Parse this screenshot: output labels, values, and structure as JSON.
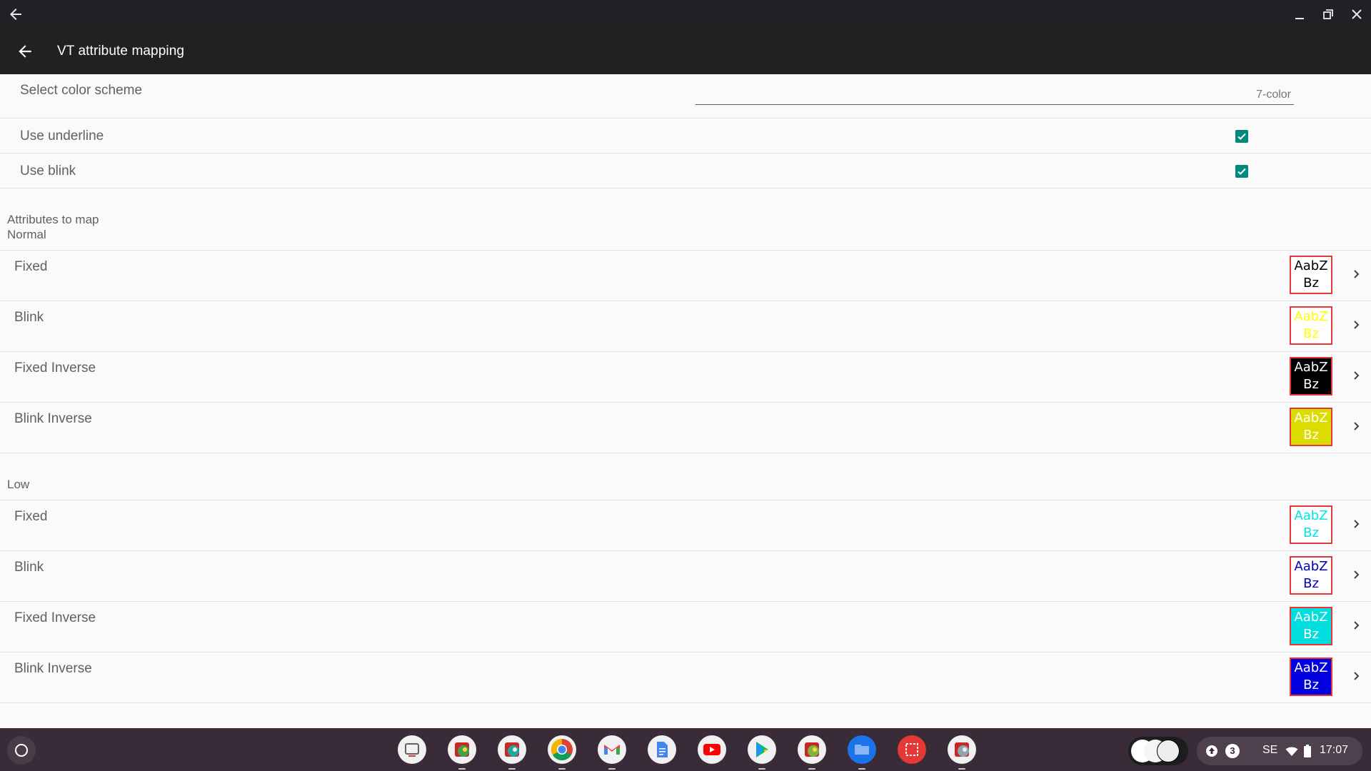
{
  "window": {
    "back_icon": "arrow-back-icon",
    "minimize_icon": "minimize-icon",
    "restore_icon": "restore-icon",
    "close_icon": "close-icon"
  },
  "appbar": {
    "title": "VT attribute mapping",
    "back_icon": "arrow-back-icon"
  },
  "settings": {
    "color_scheme": {
      "label": "Select color scheme",
      "value": "7-color"
    },
    "use_underline": {
      "label": "Use underline",
      "checked": true
    },
    "use_blink": {
      "label": "Use blink",
      "checked": true
    }
  },
  "sections": {
    "attributes_to_map": "Attributes to map",
    "normal": {
      "title": "Normal",
      "rows": [
        {
          "label": "Fixed",
          "sample": "AabZ Bz",
          "fg": "#000000",
          "bg": "#ffffff"
        },
        {
          "label": "Blink",
          "sample": "AabZ Bz",
          "fg": "#ffff00",
          "bg": "#ffffff"
        },
        {
          "label": "Fixed Inverse",
          "sample": "AabZ Bz",
          "fg": "#ffffff",
          "bg": "#000000"
        },
        {
          "label": "Blink Inverse",
          "sample": "AabZ Bz",
          "fg": "#ffffff",
          "bg": "#dcdc00"
        }
      ]
    },
    "low": {
      "title": "Low",
      "rows": [
        {
          "label": "Fixed",
          "sample": "AabZ Bz",
          "fg": "#00e5e5",
          "bg": "#ffffff"
        },
        {
          "label": "Blink",
          "sample": "AabZ Bz",
          "fg": "#0000c0",
          "bg": "#ffffff"
        },
        {
          "label": "Fixed Inverse",
          "sample": "AabZ Bz",
          "fg": "#ffffff",
          "bg": "#00dede"
        },
        {
          "label": "Blink Inverse",
          "sample": "AabZ Bz",
          "fg": "#ffffff",
          "bg": "#0000e0"
        }
      ]
    }
  },
  "shelf": {
    "launcher_icon": "launcher-icon",
    "apps": [
      {
        "name": "screen-capture-app-icon",
        "color": "#f1f1f1"
      },
      {
        "name": "terminal-app-icon",
        "color": "#f1f1f1"
      },
      {
        "name": "terminal-app-icon",
        "color": "#f1f1f1"
      },
      {
        "name": "chrome-icon",
        "color": "#f1f1f1"
      },
      {
        "name": "gmail-icon",
        "color": "#f1f1f1"
      },
      {
        "name": "docs-icon",
        "color": "#f1f1f1"
      },
      {
        "name": "youtube-icon",
        "color": "#f1f1f1"
      },
      {
        "name": "play-store-icon",
        "color": "#f1f1f1"
      },
      {
        "name": "terminal-app-icon",
        "color": "#f1f1f1"
      },
      {
        "name": "files-icon",
        "color": "#1a73e8"
      },
      {
        "name": "screenshot-app-icon",
        "color": "#e53935"
      },
      {
        "name": "terminal-app-icon",
        "color": "#f1f1f1"
      }
    ],
    "tray": {
      "notification_count": "3",
      "ime": "SE",
      "time": "17:07",
      "wifi_icon": "wifi-icon",
      "battery_icon": "battery-icon",
      "update_icon": "update-icon"
    }
  }
}
